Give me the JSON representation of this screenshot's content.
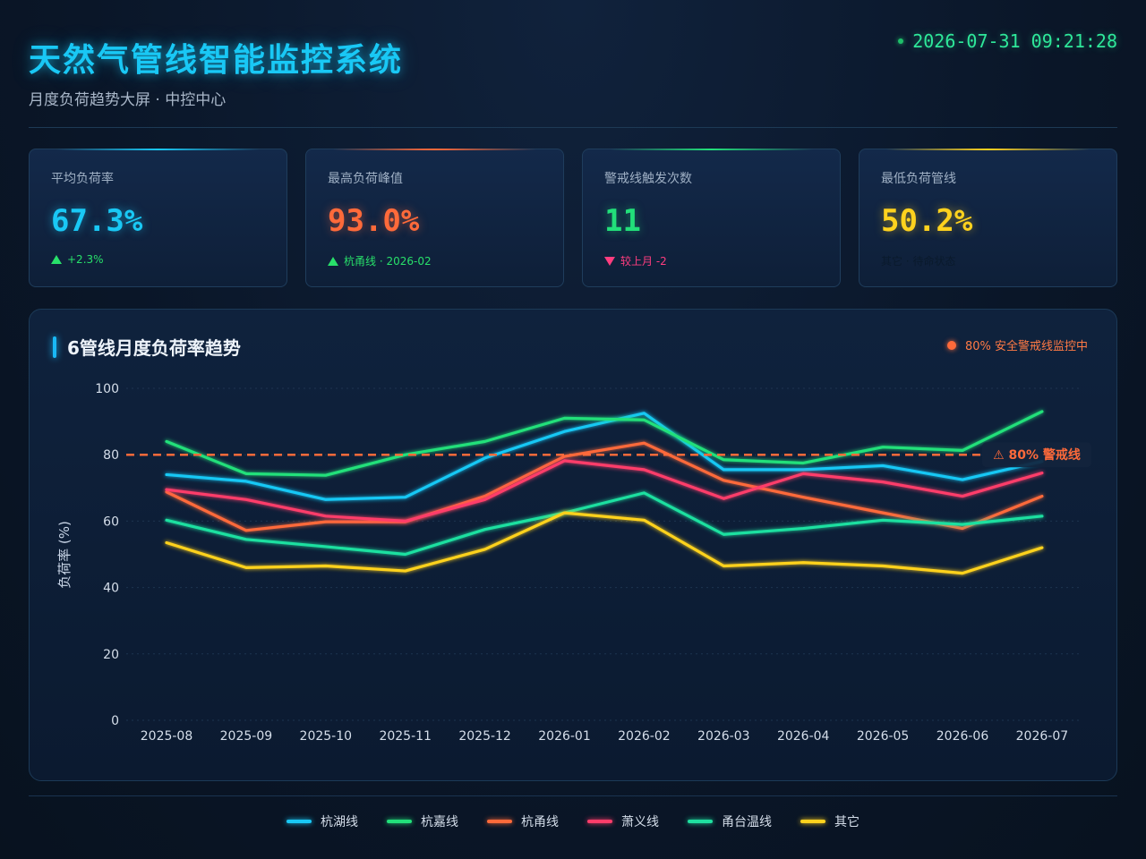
{
  "header": {
    "title": "天然气管线智能监控系统",
    "subtitle": "月度负荷趋势大屏 · 中控中心",
    "datetime": "2026-07-31 09:21:28"
  },
  "kpis": [
    {
      "label": "平均负荷率",
      "value": "67.3%",
      "sub": "+2.3%",
      "trend": "up",
      "color": "#19c8f5",
      "sub_color": "#28e06a"
    },
    {
      "label": "最高负荷峰值",
      "value": "93.0%",
      "sub": "杭甬线 · 2026-02",
      "trend": "up",
      "color": "#ff6a3a",
      "sub_color": "#28e06a"
    },
    {
      "label": "警戒线触发次数",
      "value": "11",
      "sub": "较上月 -2",
      "trend": "down",
      "color": "#22e07a",
      "sub_color": "#ff3d7f"
    },
    {
      "label": "最低负荷管线",
      "value": "50.2%",
      "sub": "其它 · 待命状态",
      "trend": "none",
      "color": "#ffd21e",
      "sub_color": "#0a1a2c"
    }
  ],
  "chart_panel": {
    "badge": "80% 安全警戒线监控中"
  },
  "chart_data": {
    "type": "line",
    "title": "6管线月度负荷率趋势",
    "ylabel": "负荷率 (%)",
    "xlabel": "",
    "ylim": [
      0,
      100
    ],
    "yticks": [
      0,
      20,
      40,
      60,
      80,
      100
    ],
    "categories": [
      "2025-08",
      "2025-09",
      "2025-10",
      "2025-11",
      "2025-12",
      "2026-01",
      "2026-02",
      "2026-03",
      "2026-04",
      "2026-05",
      "2026-06",
      "2026-07"
    ],
    "threshold": {
      "value": 80,
      "label": "⚠ 80% 警戒线",
      "color": "#ff6a3a"
    },
    "grid": true,
    "legend": "bottom",
    "series": [
      {
        "name": "杭湖线",
        "color": "#19c8f5",
        "values": [
          74,
          72,
          66.5,
          67.2,
          79,
          87,
          92.5,
          75.5,
          75.5,
          76.7,
          72.5,
          78
        ]
      },
      {
        "name": "杭嘉线",
        "color": "#22e07a",
        "values": [
          84,
          74.3,
          73.8,
          80,
          84,
          91,
          90.5,
          78.5,
          77.5,
          82.3,
          81.3,
          93
        ]
      },
      {
        "name": "杭甬线",
        "color": "#ff6a3a",
        "values": [
          68.8,
          57.2,
          59.8,
          59.8,
          67.5,
          79.5,
          83.5,
          72.3,
          67.2,
          62.5,
          57.8,
          67.5
        ]
      },
      {
        "name": "萧义线",
        "color": "#ff3d6a",
        "values": [
          69.5,
          66.5,
          61.5,
          60,
          66.5,
          78.2,
          75.5,
          66.8,
          74.3,
          71.8,
          67.5,
          74.5
        ]
      },
      {
        "name": "甬台温线",
        "color": "#1fe0a0",
        "values": [
          60.3,
          54.5,
          52.3,
          50,
          57.5,
          62.5,
          68.5,
          56,
          57.8,
          60.3,
          59,
          61.5
        ]
      },
      {
        "name": "其它",
        "color": "#ffd21e",
        "values": [
          53.5,
          46,
          46.5,
          45,
          51.5,
          62.5,
          60.3,
          46.5,
          47.5,
          46.5,
          44.3,
          52
        ]
      }
    ]
  }
}
